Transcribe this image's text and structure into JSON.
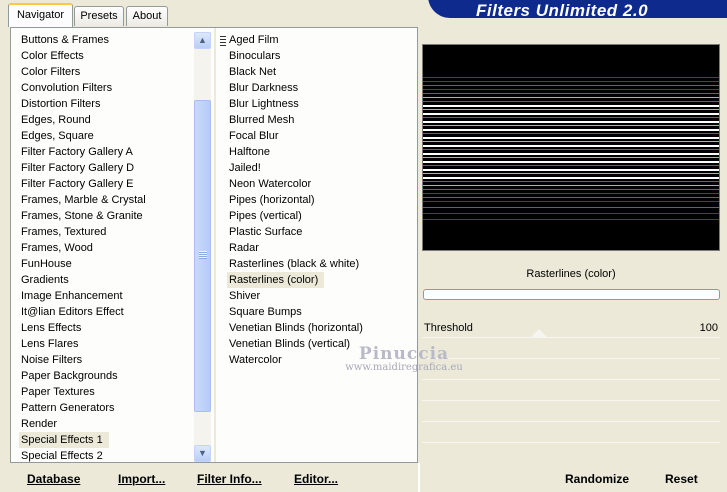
{
  "tabs": [
    {
      "label": "Navigator",
      "active": true
    },
    {
      "label": "Presets",
      "active": false
    },
    {
      "label": "About",
      "active": false
    }
  ],
  "header": {
    "title": "Filters Unlimited 2.0"
  },
  "categories": {
    "items": [
      "Buttons & Frames",
      "Color Effects",
      "Color Filters",
      "Convolution Filters",
      "Distortion Filters",
      "Edges, Round",
      "Edges, Square",
      "Filter Factory Gallery A",
      "Filter Factory Gallery D",
      "Filter Factory Gallery E",
      "Frames, Marble & Crystal",
      "Frames, Stone & Granite",
      "Frames, Textured",
      "Frames, Wood",
      "FunHouse",
      "Gradients",
      "Image Enhancement",
      "It@lian Editors Effect",
      "Lens Effects",
      "Lens Flares",
      "Noise Filters",
      "Paper Backgrounds",
      "Paper Textures",
      "Pattern Generators",
      "Render",
      "Special Effects 1",
      "Special Effects 2"
    ],
    "selected": "Special Effects 1",
    "scroll_up_icon": "chevron-up-icon",
    "scroll_down_icon": "chevron-down-icon"
  },
  "filters": {
    "items": [
      "Aged Film",
      "Binoculars",
      "Black Net",
      "Blur Darkness",
      "Blur Lightness",
      "Blurred Mesh",
      "Focal Blur",
      "Halftone",
      "Jailed!",
      "Neon Watercolor",
      "Pipes (horizontal)",
      "Pipes (vertical)",
      "Plastic Surface",
      "Radar",
      "Rasterlines (black & white)",
      "Rasterlines (color)",
      "Shiver",
      "Square Bumps",
      "Venetian Blinds (horizontal)",
      "Venetian Blinds (vertical)",
      "Watercolor"
    ],
    "selected": "Rasterlines (color)"
  },
  "preview": {
    "filter_name": "Rasterlines (color)",
    "colors": {
      "background": "#000000",
      "blue": "#2233ff",
      "magenta": "#c020d0",
      "pink": "#ff80e0",
      "white": "#ffffff"
    }
  },
  "params": [
    {
      "label": "Threshold",
      "value": "100"
    }
  ],
  "toolbar": {
    "database": "Database",
    "import": "Import...",
    "filter_info": "Filter Info...",
    "editor": "Editor...",
    "randomize": "Randomize",
    "reset": "Reset"
  },
  "watermark": {
    "title": "Pinuccia",
    "url": "www.maidiregrafica.eu"
  }
}
